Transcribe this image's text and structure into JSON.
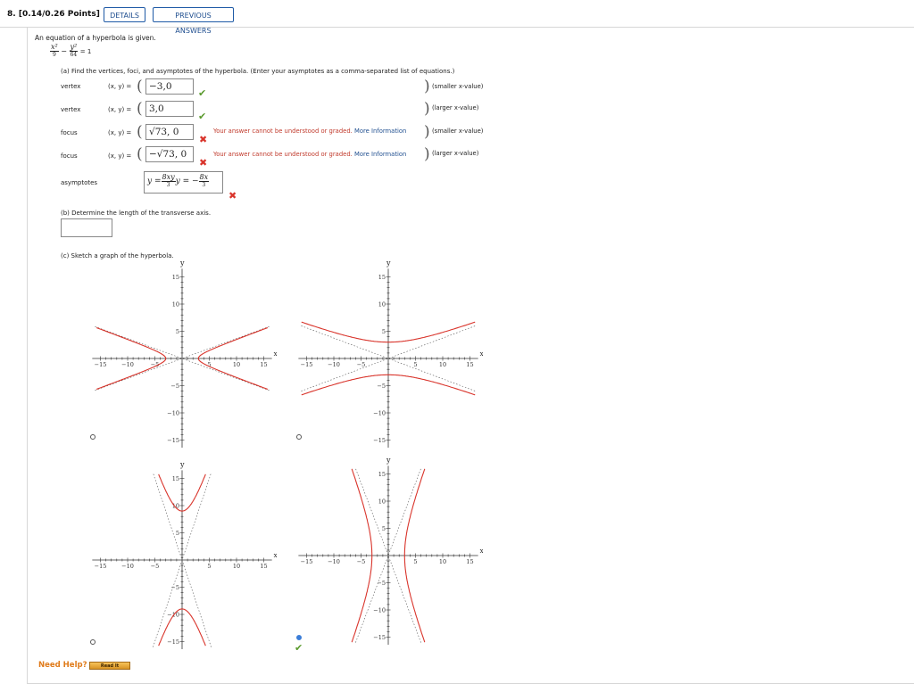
{
  "header": {
    "question_number": "8.",
    "points": "[0.14/0.26 Points]",
    "details_button": "DETAILS",
    "previous_answers_button": "PREVIOUS ANSWERS"
  },
  "prompt": {
    "intro": "An equation of a hyperbola is given.",
    "equation": {
      "num1": "x²",
      "den1": "9",
      "minus": "−",
      "num2": "y²",
      "den2": "64",
      "rhs": "= 1"
    }
  },
  "part_a": {
    "instruction": "(a) Find the vertices, foci, and asymptotes of the hyperbola. (Enter your asymptotes as a comma-separated list of equations.)",
    "xy_label": "(x, y) =",
    "rows": [
      {
        "label": "vertex",
        "value": "−3,0",
        "hint": "(smaller x-value)",
        "status": "correct",
        "mark": "✔"
      },
      {
        "label": "vertex",
        "value": "3,0",
        "hint": "(larger x-value)",
        "status": "correct",
        "mark": "✔"
      },
      {
        "label": "focus",
        "value": "√73, 0",
        "hint": "(smaller x-value)",
        "status": "incorrect",
        "mark": "✖",
        "error": "Your answer cannot be understood or graded.",
        "more": "More Information"
      },
      {
        "label": "focus",
        "value": "−√73, 0",
        "hint": "(larger x-value)",
        "status": "incorrect",
        "mark": "✖",
        "error": "Your answer cannot be understood or graded.",
        "more": "More Information"
      }
    ],
    "asymptotes": {
      "label": "asymptotes",
      "eq1_lhs": "y =",
      "eq1_num": "8xy",
      "eq1_den": "3",
      "eq2_lhs": "y = −",
      "eq2_num": "8x",
      "eq2_den": "3",
      "status": "incorrect",
      "mark": "✖"
    }
  },
  "part_b": {
    "instruction": "(b) Determine the length of the transverse axis.",
    "value": ""
  },
  "part_c": {
    "instruction": "(c) Sketch a graph of the hyperbola.",
    "selected_check": "✔",
    "graphs": [
      {
        "id": "A",
        "selected": false,
        "orientation": "horizontal",
        "a": 3,
        "b": 1.1
      },
      {
        "id": "B",
        "selected": false,
        "orientation": "vertical",
        "a": 3,
        "b": 8
      },
      {
        "id": "C",
        "selected": false,
        "orientation": "vertical-steep",
        "a": 9,
        "b": 3
      },
      {
        "id": "D",
        "selected": true,
        "orientation": "horizontal-steep",
        "a": 3,
        "b": 8
      }
    ],
    "axis": {
      "x_label": "x",
      "y_label": "y",
      "ticks": [
        "−15",
        "−10",
        "−5",
        "5",
        "10",
        "15"
      ],
      "tick_values": [
        -15,
        -10,
        -5,
        5,
        10,
        15
      ],
      "range": [
        -16,
        16
      ]
    }
  },
  "help": {
    "need_help": "Need Help?",
    "read_it": "Read It"
  }
}
